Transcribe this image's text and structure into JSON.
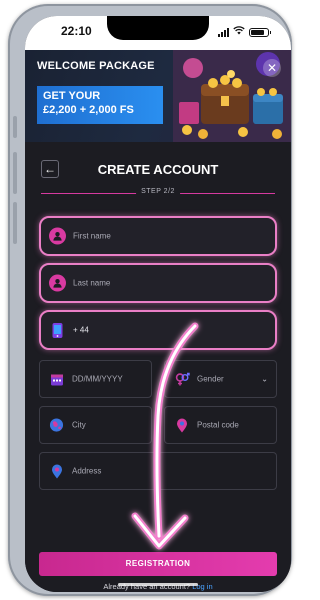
{
  "status_bar": {
    "time": "22:10"
  },
  "banner": {
    "title": "WELCOME PACKAGE",
    "promo_line1": "GET YOUR",
    "promo_line2": "£2,200 + 2,000 FS",
    "close_icon": "close-icon"
  },
  "form": {
    "title": "CREATE ACCOUNT",
    "step": "STEP 2/2",
    "fields": {
      "first_name": {
        "placeholder": "First name",
        "icon": "user-icon"
      },
      "last_name": {
        "placeholder": "Last name",
        "icon": "user-icon"
      },
      "phone": {
        "value": "+ 44",
        "icon": "phone-icon"
      },
      "dob": {
        "placeholder": "DD/MM/YYYY",
        "icon": "calendar-icon"
      },
      "gender": {
        "placeholder": "Gender",
        "icon": "gender-icon"
      },
      "city": {
        "placeholder": "City",
        "icon": "globe-icon"
      },
      "postal": {
        "placeholder": "Postal code",
        "icon": "map-pin-icon"
      },
      "address": {
        "placeholder": "Address",
        "icon": "map-pin-icon"
      }
    },
    "register_label": "REGISTRATION",
    "login_prompt": "Already have an account?",
    "login_link": "Log in"
  },
  "colors": {
    "accent": "#e43cae",
    "highlight": "#ea7fc6",
    "promo": "#1f6fd1",
    "link": "#4aa3ff",
    "background": "#1c1c22"
  }
}
